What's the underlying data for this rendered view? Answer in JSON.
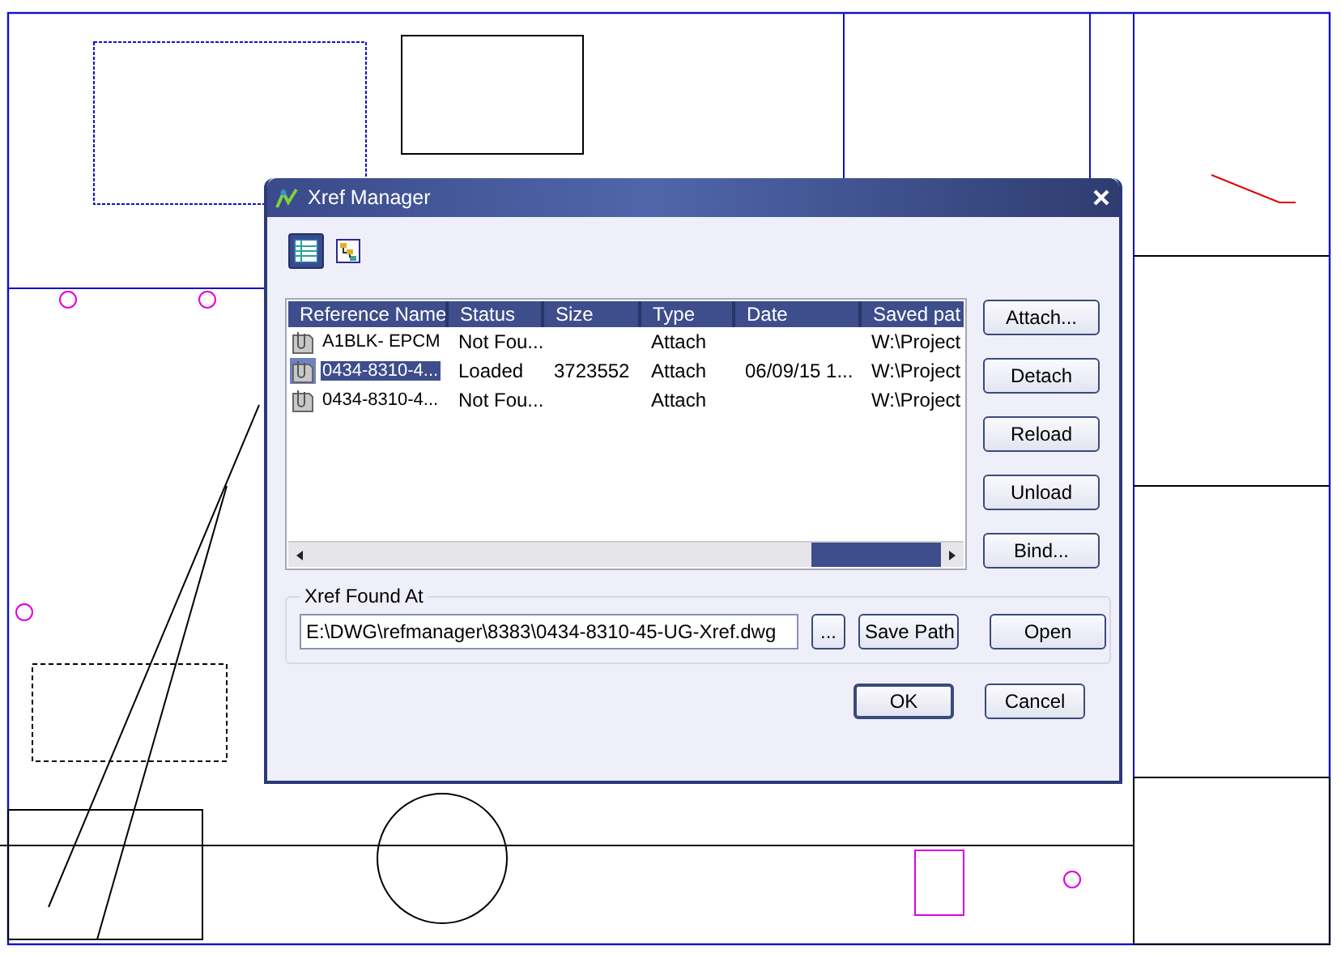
{
  "window": {
    "title": "Xref Manager"
  },
  "view_buttons": [
    {
      "kind": "list",
      "selected": true
    },
    {
      "kind": "tree",
      "selected": false
    }
  ],
  "table": {
    "columns": [
      "Reference Name",
      "Status",
      "Size",
      "Type",
      "Date",
      "Saved pat"
    ],
    "rows": [
      {
        "name": "A1BLK- EPCM",
        "status": "Not Fou...",
        "size": "",
        "type": "Attach",
        "date": "",
        "saved_path": "W:\\Project",
        "selected": false
      },
      {
        "name": "0434-8310-4...",
        "status": "Loaded",
        "size": "3723552",
        "type": "Attach",
        "date": "06/09/15 1...",
        "saved_path": "W:\\Project",
        "selected": true
      },
      {
        "name": "0434-8310-4...",
        "status": "Not Fou...",
        "size": "",
        "type": "Attach",
        "date": "",
        "saved_path": "W:\\Project",
        "selected": false
      }
    ]
  },
  "side_buttons": [
    "Attach...",
    "Detach",
    "Reload",
    "Unload",
    "Bind..."
  ],
  "found_at": {
    "label": "Xref Found At",
    "value": "E:\\DWG\\refmanager\\8383\\0434-8310-45-UG-Xref.dwg",
    "browse": "...",
    "save_path": "Save Path",
    "open": "Open"
  },
  "footer_buttons": [
    "OK",
    "Cancel"
  ]
}
